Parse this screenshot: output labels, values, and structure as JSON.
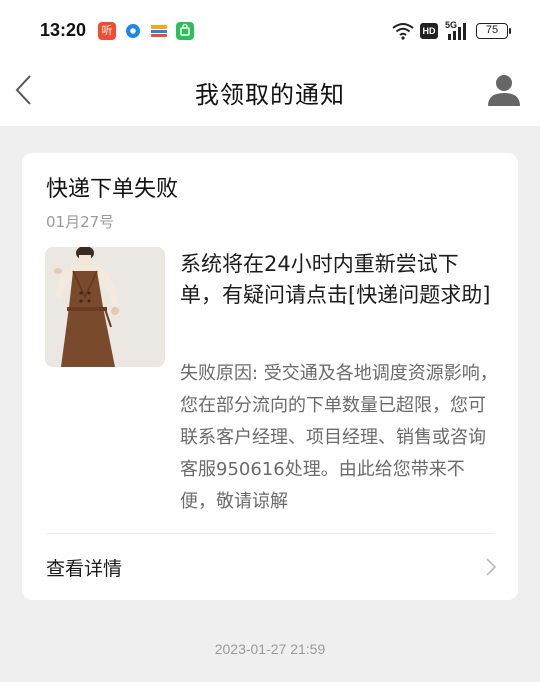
{
  "status_bar": {
    "time": "13:20",
    "app_icons": [
      {
        "name": "ting-app-icon",
        "glyph": "听",
        "color": "#f24d2e"
      },
      {
        "name": "browser-app-icon",
        "glyph": "",
        "color": "#1e88e5"
      },
      {
        "name": "wallet-app-icon",
        "glyph": "",
        "color": "#f5a623"
      },
      {
        "name": "shopping-app-icon",
        "glyph": "",
        "color": "#2fbf5a"
      }
    ],
    "hd_label": "HD",
    "network_label": "5G",
    "battery": "75"
  },
  "nav": {
    "title": "我领取的通知"
  },
  "notification": {
    "title": "快递下单失败",
    "date": "01月27号",
    "headline": "系统将在24小时内重新尝试下单，有疑问请点击[快递问题求助]",
    "reason": "失败原因: 受交通及各地调度资源影响，您在部分流向的下单数量已超限，您可联系客户经理、项目经理、销售或咨询客服950616处理。由此给您带来不便，敬请谅解",
    "details_label": "查看详情"
  },
  "footer": {
    "timestamp": "2023-01-27 21:59"
  },
  "colors": {
    "background": "#efefef",
    "card": "#ffffff",
    "muted_text": "#999999"
  }
}
